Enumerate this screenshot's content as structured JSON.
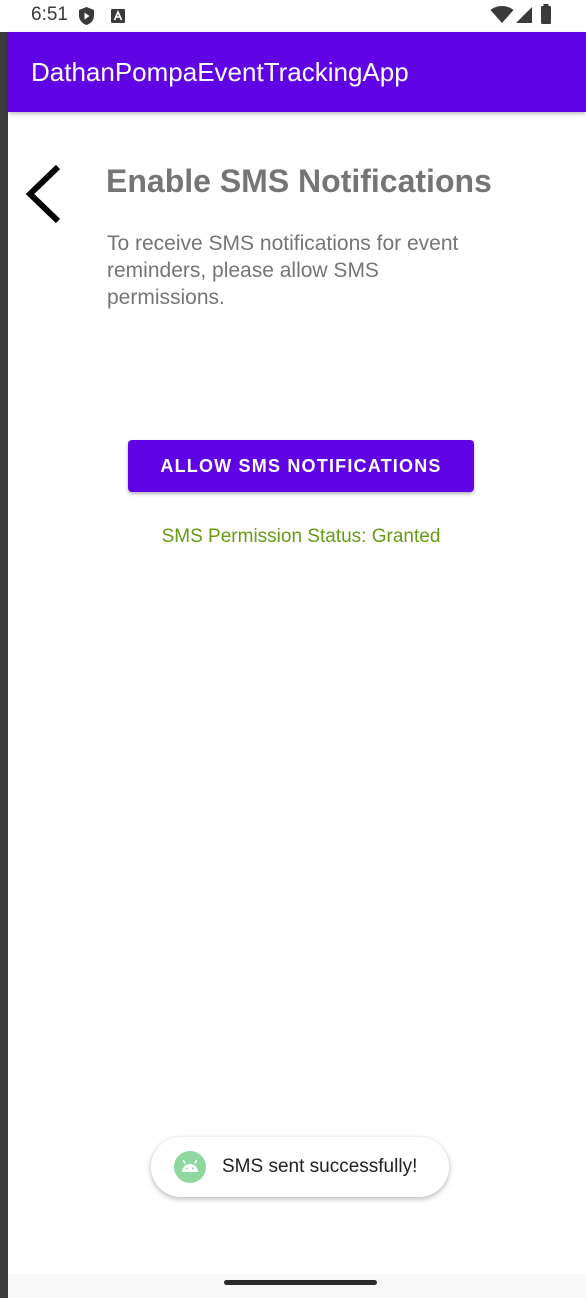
{
  "status_bar": {
    "time": "6:51",
    "left_icons": [
      "shield-play-icon",
      "font-a-icon"
    ],
    "right_icons": [
      "wifi-icon",
      "signal-icon",
      "battery-icon"
    ]
  },
  "app_bar": {
    "title": "DathanPompaEventTrackingApp",
    "color": "#6004e5"
  },
  "content": {
    "back_icon": "chevron-left-icon",
    "title": "Enable SMS Notifications",
    "description": "To receive SMS notifications for event reminders, please allow SMS permissions.",
    "allow_button_label": "ALLOW SMS NOTIFICATIONS",
    "permission_status": "SMS Permission Status: Granted",
    "status_color": "#649b14"
  },
  "toast": {
    "icon": "android-robot-icon",
    "message": "SMS sent successfully!"
  },
  "nav": {
    "handle_icon": "gesture-handle-icon"
  }
}
